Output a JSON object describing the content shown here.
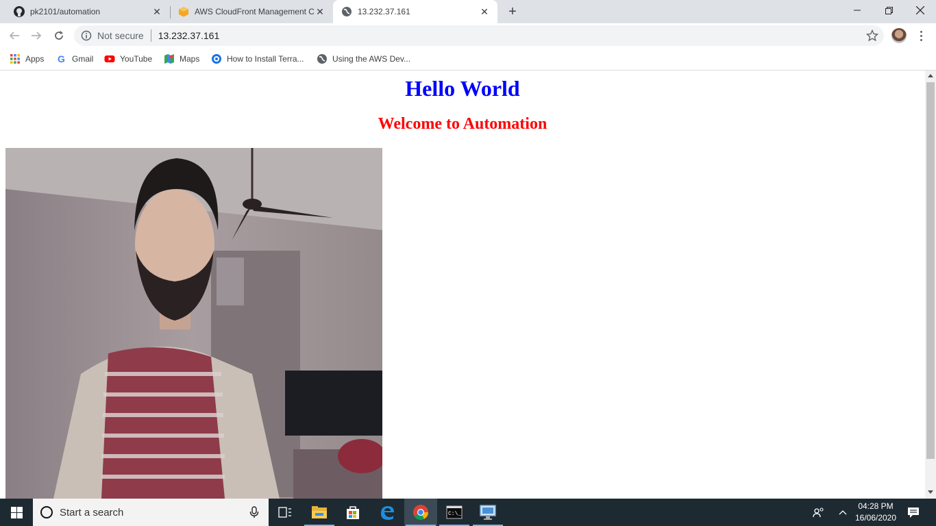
{
  "tabs": [
    {
      "title": "pk2101/automation",
      "icon": "github-icon",
      "active": false
    },
    {
      "title": "AWS CloudFront Management Co",
      "icon": "aws-box-icon",
      "active": false
    },
    {
      "title": "13.232.37.161",
      "icon": "globe-icon",
      "active": true
    }
  ],
  "omnibox": {
    "security_label": "Not secure",
    "url": "13.232.37.161"
  },
  "bookmarks": [
    {
      "label": "Apps",
      "icon": "apps-grid-icon"
    },
    {
      "label": "Gmail",
      "icon": "google-icon"
    },
    {
      "label": "YouTube",
      "icon": "youtube-icon"
    },
    {
      "label": "Maps",
      "icon": "maps-icon"
    },
    {
      "label": "How to Install Terra...",
      "icon": "bookmark-site-icon"
    },
    {
      "label": "Using the AWS Dev...",
      "icon": "globe-icon"
    }
  ],
  "page": {
    "heading": "Hello World",
    "subheading": "Welcome to Automation",
    "heading_color": "#0000ff",
    "subheading_color": "#ff0000"
  },
  "taskbar": {
    "search_placeholder": "Start a search",
    "time": "04:28 PM",
    "date": "16/06/2020",
    "accent": "#76b9ed"
  }
}
